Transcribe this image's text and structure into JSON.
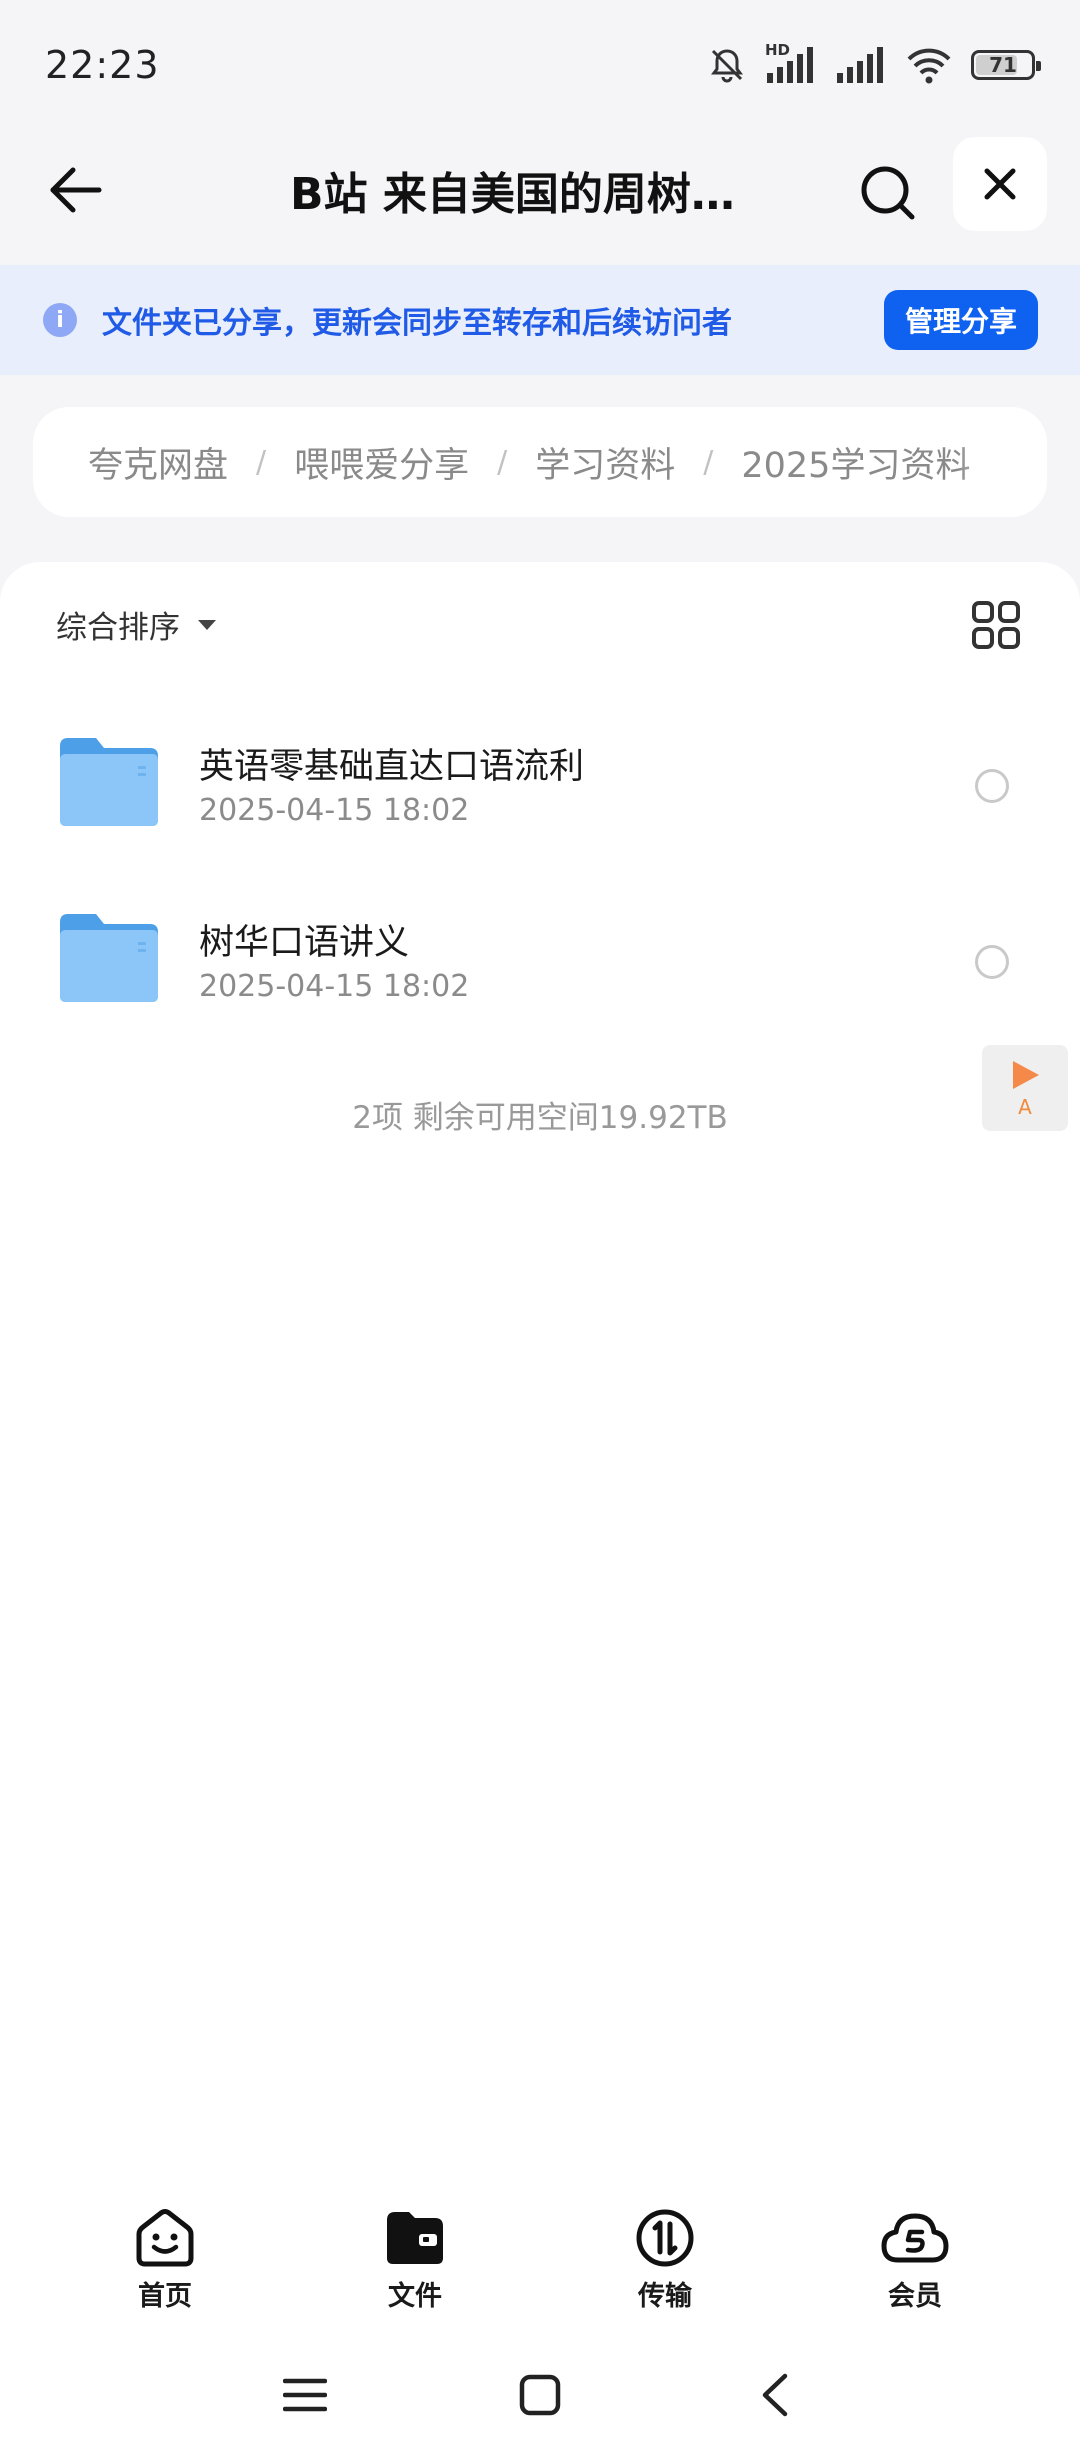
{
  "status_bar": {
    "time": "22:23",
    "network_label": "HD",
    "battery_level": "71"
  },
  "header": {
    "title": "B站 来自美国的周树华...",
    "back_icon": "arrow-left-icon",
    "search_icon": "search-icon",
    "close_icon": "close-icon"
  },
  "share_banner": {
    "info_icon_text": "i",
    "message": "文件夹已分享，更新会同步至转存和后续访问者",
    "manage_button": "管理分享"
  },
  "breadcrumb": {
    "items": [
      "夸克网盘",
      "喂喂爱分享",
      "学习资料",
      "2025学习资料"
    ],
    "separator": "/"
  },
  "toolbar": {
    "sort_label": "综合排序",
    "view_toggle_icon": "grid-view-icon"
  },
  "files": [
    {
      "name": "英语零基础直达口语流利",
      "date": "2025-04-15 18:02",
      "icon": "folder-icon"
    },
    {
      "name": "树华口语讲义",
      "date": "2025-04-15 18:02",
      "icon": "folder-icon"
    }
  ],
  "summary": "2项 剩余可用空间19.92TB",
  "float_badge": {
    "letter": "A",
    "icon": "play-icon"
  },
  "bottom_nav": [
    {
      "label": "首页",
      "icon": "smiley-home-icon"
    },
    {
      "label": "文件",
      "icon": "folder-wallet-icon"
    },
    {
      "label": "传输",
      "icon": "transfer-icon"
    },
    {
      "label": "会员",
      "icon": "cloud-vip-icon"
    }
  ],
  "colors": {
    "accent": "#0f62f0",
    "banner_bg": "#e9eefc",
    "banner_text": "#1f5be6",
    "folder": "#5aa9f0"
  }
}
